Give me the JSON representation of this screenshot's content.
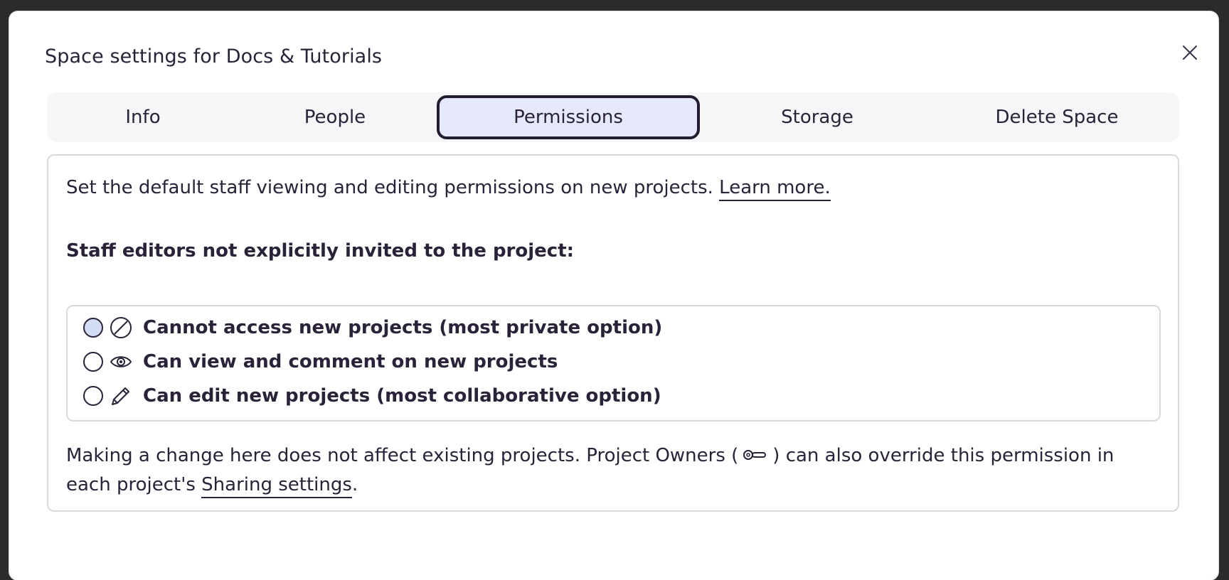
{
  "modal": {
    "title": "Space settings for Docs & Tutorials",
    "close_icon": "close-icon"
  },
  "tabs": [
    {
      "label": "Info",
      "active": false
    },
    {
      "label": "People",
      "active": false
    },
    {
      "label": "Permissions",
      "active": true
    },
    {
      "label": "Storage",
      "active": false
    },
    {
      "label": "Delete Space",
      "active": false
    }
  ],
  "permissions": {
    "intro_text": "Set the default staff viewing and editing permissions on new projects.",
    "learn_more_link": "Learn more.",
    "section_label": "Staff editors not explicitly invited to the project:",
    "options": [
      {
        "label": "Cannot access new projects (most private option)",
        "icon": "no-access-icon",
        "selected": true
      },
      {
        "label": "Can view and comment on new projects",
        "icon": "eye-icon",
        "selected": false
      },
      {
        "label": "Can edit new projects (most collaborative option)",
        "icon": "pencil-icon",
        "selected": false
      }
    ],
    "footnote_prefix": "Making a change here does not affect existing projects. Project Owners (",
    "footnote_owner_icon": "key-icon",
    "footnote_middle": ") can also override this permission in each project's",
    "sharing_settings_link": "Sharing settings",
    "footnote_suffix": "."
  },
  "colors": {
    "text": "#2a2238",
    "active_tab_bg": "#e6e9fc",
    "tabbar_bg": "#f6f6f8",
    "radio_selected_fill": "#d5dcf6",
    "border": "#d9d9de"
  }
}
